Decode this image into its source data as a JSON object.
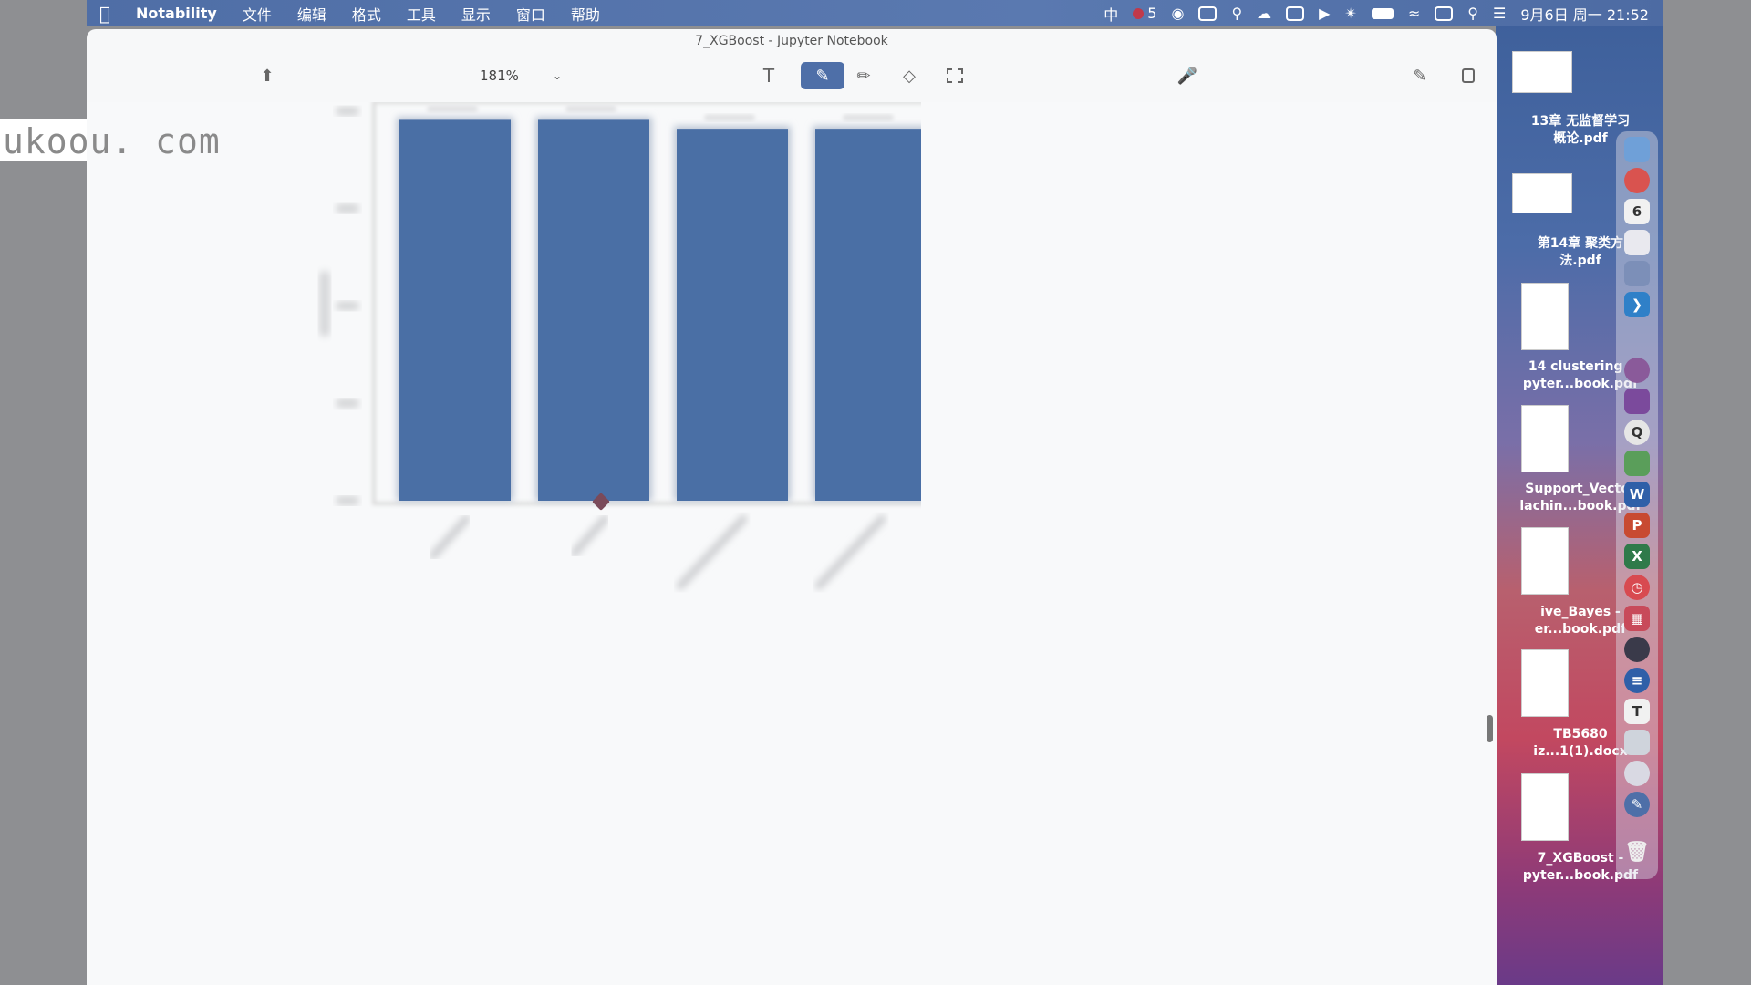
{
  "menubar": {
    "apple_icon": "apple-icon",
    "app": "Notability",
    "items": [
      "文件",
      "编辑",
      "格式",
      "工具",
      "显示",
      "窗口",
      "帮助"
    ],
    "input_method": "中",
    "notification_count": "5",
    "datetime": "9月6日 周一 21:52"
  },
  "window": {
    "title": "7_XGBoost - Jupyter Notebook",
    "zoom": "181%"
  },
  "toolbar": {
    "share_icon": "share-icon",
    "tools": [
      "text-tool-icon",
      "pen-tool-icon",
      "highlighter-tool-icon",
      "eraser-tool-icon",
      "lasso-tool-icon"
    ],
    "active_tool": "pen-tool-icon",
    "mic_icon": "microphone-icon",
    "right_icons": [
      "edit-icon",
      "pages-icon"
    ]
  },
  "watermark": "ukoou. com",
  "chart_data": {
    "type": "bar",
    "note_values_estimated": true,
    "categories": [
      "",
      "",
      "",
      ""
    ],
    "values": [
      4.3,
      4.3,
      4.2,
      4.2
    ],
    "ylim": [
      0,
      4.5
    ],
    "bar_color": "#4a6fa5",
    "title": "",
    "xlabel": "",
    "ylabel": "",
    "grid": false
  },
  "desktop_files": [
    {
      "line1": "13章 无监督学习",
      "line2": "概论.pdf"
    },
    {
      "line1": "第14章 聚类方",
      "line2": "法.pdf"
    },
    {
      "line1": "14 clustering -",
      "line2": "pyter...book.pdf"
    },
    {
      "line1": "Support_Vector",
      "line2": "lachin...book.pdf"
    },
    {
      "line1": "ive_Bayes -",
      "line2": "er...book.pdf"
    },
    {
      "line1": "TB5680",
      "line2": "iz...1(1).docx"
    },
    {
      "line1": "7_XGBoost -",
      "line2": "pyter...book.pdf"
    }
  ],
  "colors": {
    "menubar": "#5574ad",
    "bar": "#4a6fa5",
    "active_tool_bg": "#4e6fa8"
  }
}
